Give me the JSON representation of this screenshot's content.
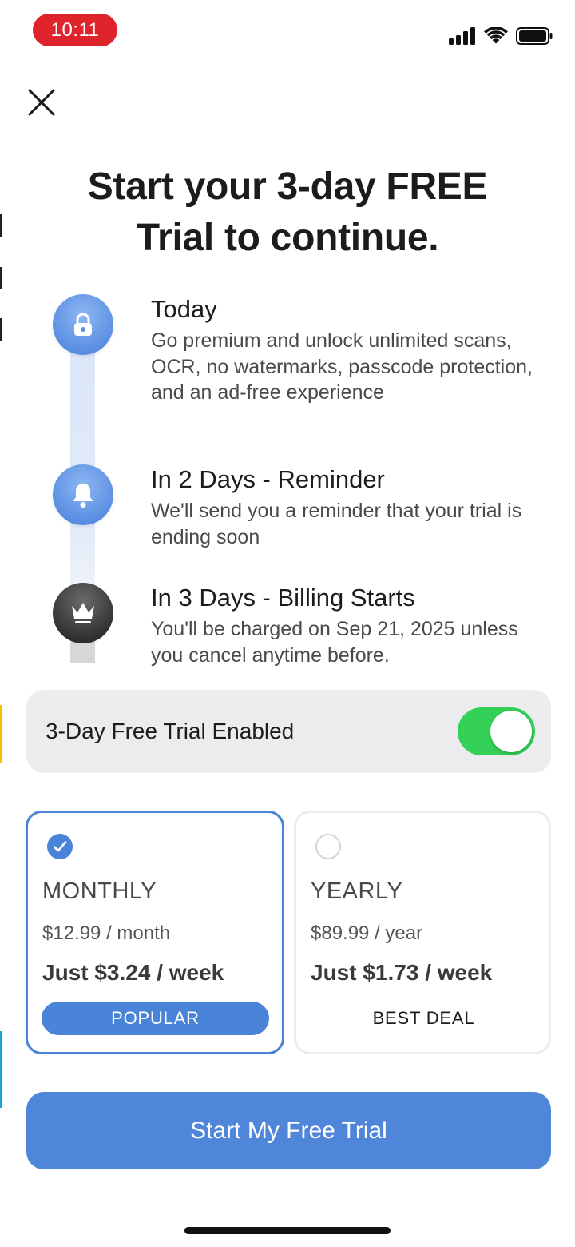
{
  "status_bar": {
    "time": "10:11",
    "icons": [
      "cellular-signal-icon",
      "wifi-icon",
      "battery-icon"
    ]
  },
  "close_icon": "close-icon",
  "headline": {
    "line1": "Start your 3-day FREE",
    "line2": "Trial to continue."
  },
  "timeline": {
    "steps": [
      {
        "icon": "lock-icon",
        "title": "Today",
        "description": "Go premium and unlock unlimited scans, OCR, no watermarks, passcode protection, and an ad-free experience"
      },
      {
        "icon": "bell-icon",
        "title": "In 2 Days - Reminder",
        "description": "We'll send you a reminder that your trial is ending soon"
      },
      {
        "icon": "crown-icon",
        "title": "In 3 Days - Billing Starts",
        "description": "You'll be charged on Sep 21, 2025 unless you cancel anytime before."
      }
    ]
  },
  "trial_toggle": {
    "label": "3-Day Free Trial Enabled",
    "enabled": true,
    "on_color": "#34d058"
  },
  "plans": [
    {
      "name": "MONTHLY",
      "price": "$12.99 / month",
      "weekly": "Just $3.24 / week",
      "badge": "POPULAR",
      "selected": true
    },
    {
      "name": "YEARLY",
      "price": "$89.99 / year",
      "weekly": "Just $1.73 / week",
      "badge": "BEST DEAL",
      "selected": false
    }
  ],
  "cta": {
    "label": "Start My Free Trial"
  },
  "colors": {
    "accent": "#4a84d8",
    "time_pill": "#e0242c"
  }
}
